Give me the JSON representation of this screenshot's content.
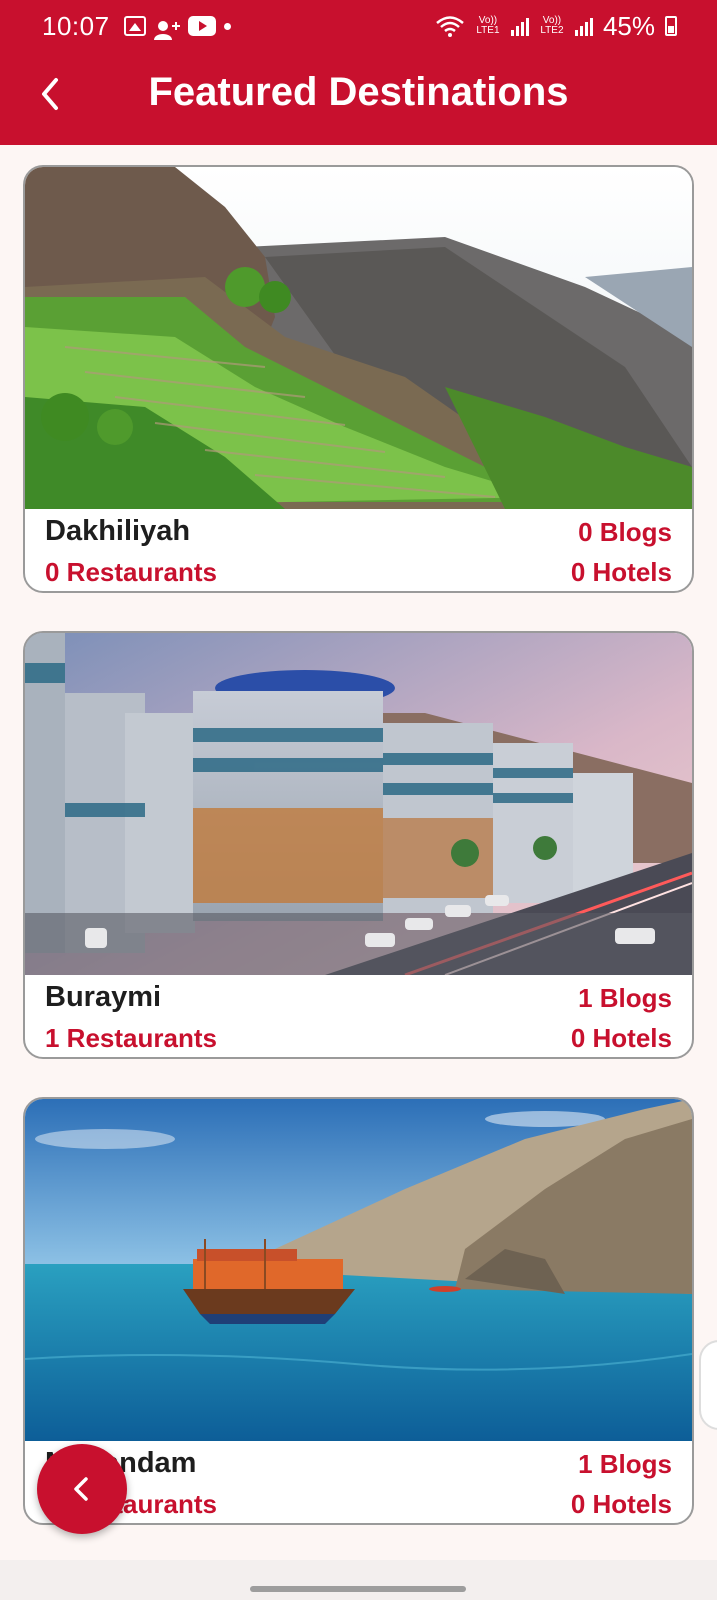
{
  "status_bar": {
    "time": "10:07",
    "network1": "Vo)) LTE1",
    "network2": "Vo)) LTE2",
    "battery": "45%"
  },
  "header": {
    "title": "Featured Destinations",
    "background_color": "#c8102e"
  },
  "destinations": [
    {
      "name": "Dakhiliyah",
      "blogs": "0 Blogs",
      "restaurants": "0 Restaurants",
      "hotels": "0 Hotels"
    },
    {
      "name": "Buraymi",
      "blogs": "1 Blogs",
      "restaurants": "1 Restaurants",
      "hotels": "0 Hotels"
    },
    {
      "name": "Musandam",
      "blogs": "1 Blogs",
      "restaurants": "0 Restaurants",
      "hotels": "0 Hotels"
    }
  ],
  "icons": {
    "back": "chevron-left-icon",
    "fab": "chevron-left-icon"
  },
  "accent_color": "#c8102e"
}
